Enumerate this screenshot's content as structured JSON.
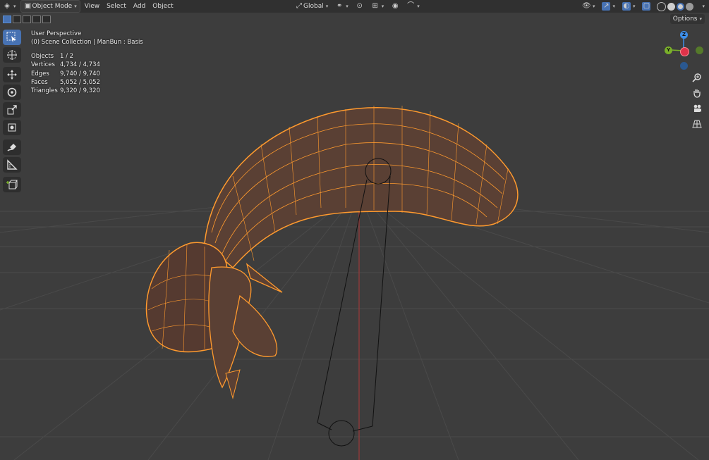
{
  "header": {
    "mode_label": "Object Mode",
    "menus": [
      "View",
      "Select",
      "Add",
      "Object"
    ],
    "transform_orientation": "Global"
  },
  "options_label": "Options",
  "overlay": {
    "view_name": "User Perspective",
    "collection_info": "(0) Scene Collection | ManBun : Basis",
    "stats": [
      {
        "label": "Objects",
        "value": "1 / 2"
      },
      {
        "label": "Vertices",
        "value": "4,734 / 4,734"
      },
      {
        "label": "Edges",
        "value": "9,740 / 9,740"
      },
      {
        "label": "Faces",
        "value": "5,052 / 5,052"
      },
      {
        "label": "Triangles",
        "value": "9,320 / 9,320"
      }
    ]
  },
  "gizmo": {
    "z_label": "Z",
    "y_label": "Y"
  },
  "toolbar_tools": [
    "select-box",
    "cursor",
    "move",
    "rotate",
    "scale",
    "transform",
    "annotate",
    "measure",
    "add-cube"
  ],
  "colors": {
    "background": "#3d3d3d",
    "header": "#303030",
    "accent": "#4772b3",
    "selection": "#ff9a2e",
    "axis_x": "#e0334a",
    "axis_y": "#7ab02a",
    "axis_z": "#3d8ee8"
  }
}
